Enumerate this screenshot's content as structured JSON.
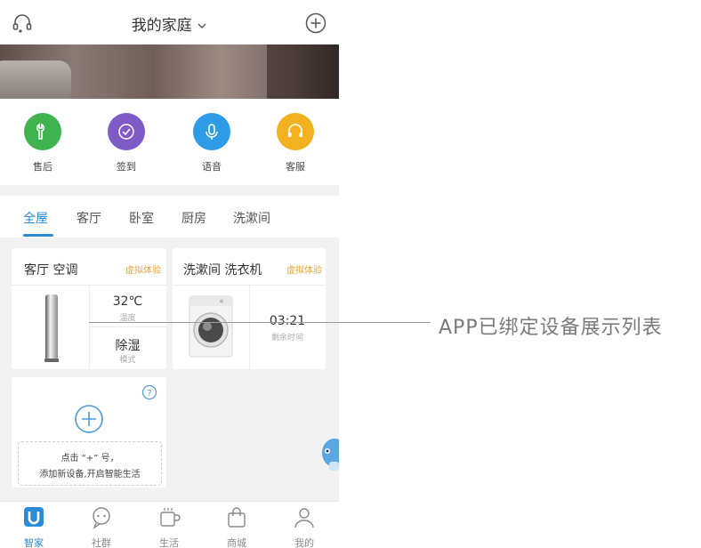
{
  "header": {
    "title": "我的家庭",
    "left_icon": "headset-icon",
    "right_icon": "add-circle-icon"
  },
  "quick_actions": [
    {
      "label": "售后",
      "icon": "wrench-icon",
      "color": "#3fb34f"
    },
    {
      "label": "签到",
      "icon": "check-circle-icon",
      "color": "#7e5bc6"
    },
    {
      "label": "语音",
      "icon": "microphone-icon",
      "color": "#2f9be6"
    },
    {
      "label": "客服",
      "icon": "headset-icon",
      "color": "#f2b120"
    }
  ],
  "tabs": [
    {
      "label": "全屋",
      "active": true
    },
    {
      "label": "客厅",
      "active": false
    },
    {
      "label": "卧室",
      "active": false
    },
    {
      "label": "厨房",
      "active": false
    },
    {
      "label": "洗漱间",
      "active": false
    }
  ],
  "devices": [
    {
      "title": "客厅 空调",
      "tag": "虚拟体验",
      "stats": [
        {
          "value": "32℃",
          "label": "温度"
        },
        {
          "value": "除湿",
          "label": "模式"
        }
      ]
    },
    {
      "title": "洗漱间 洗衣机",
      "tag": "虚拟体验",
      "stats": [
        {
          "value": "03:21",
          "label": "剩余时间"
        }
      ]
    }
  ],
  "add_device": {
    "line1": "点击 “+” 号，",
    "line2": "添加新设备,开启智能生活"
  },
  "bottom_nav": [
    {
      "label": "智家",
      "icon": "u-logo-icon",
      "active": true
    },
    {
      "label": "社群",
      "icon": "chat-icon",
      "active": false
    },
    {
      "label": "生活",
      "icon": "cup-icon",
      "active": false
    },
    {
      "label": "商城",
      "icon": "shopping-bag-icon",
      "active": false
    },
    {
      "label": "我的",
      "icon": "user-icon",
      "active": false
    }
  ],
  "callout": {
    "text": "APP已绑定设备展示列表"
  },
  "colors": {
    "accent": "#2a8bd6",
    "tag": "#e8a33a",
    "background": "#f2f2f2"
  }
}
